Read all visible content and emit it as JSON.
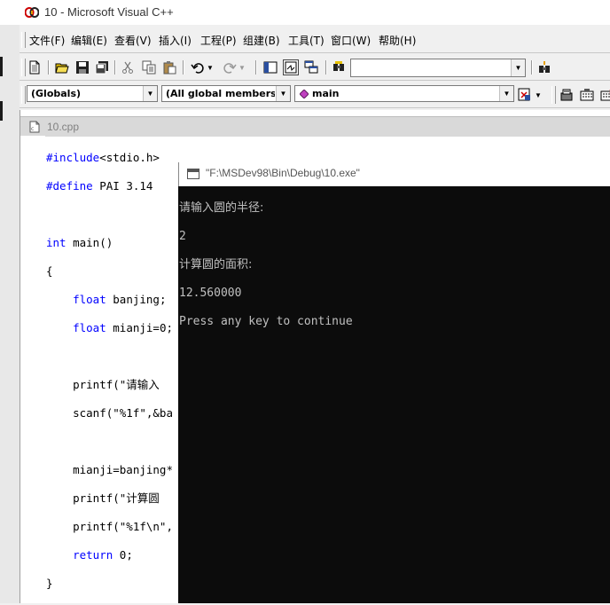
{
  "window": {
    "title": "10 - Microsoft Visual C++"
  },
  "menu": [
    "文件(F)",
    "编辑(E)",
    "查看(V)",
    "插入(I)",
    "工程(P)",
    "组建(B)",
    "工具(T)",
    "窗口(W)",
    "帮助(H)"
  ],
  "wizard_bar": {
    "scope": "(Globals)",
    "members": "(All global members",
    "function": "main"
  },
  "editor": {
    "tab_name": "10.cpp",
    "lines": [
      "#include<stdio.h>",
      "#define PAI 3.14",
      "",
      "int main()",
      "{",
      "    float banjing;",
      "    float mianji=0;",
      "",
      "    printf(\"请输入",
      "    scanf(\"%1f\",&ba",
      "",
      "    mianji=banjing*",
      "    printf(\"计算圆",
      "    printf(\"%1f\\n\",",
      "    return 0;",
      "}"
    ]
  },
  "console": {
    "title": "\"F:\\MSDev98\\Bin\\Debug\\10.exe\"",
    "lines": [
      "请输入圆的半径:",
      "2",
      "计算圆的面积:",
      "12.560000",
      "Press any key to continue"
    ]
  }
}
